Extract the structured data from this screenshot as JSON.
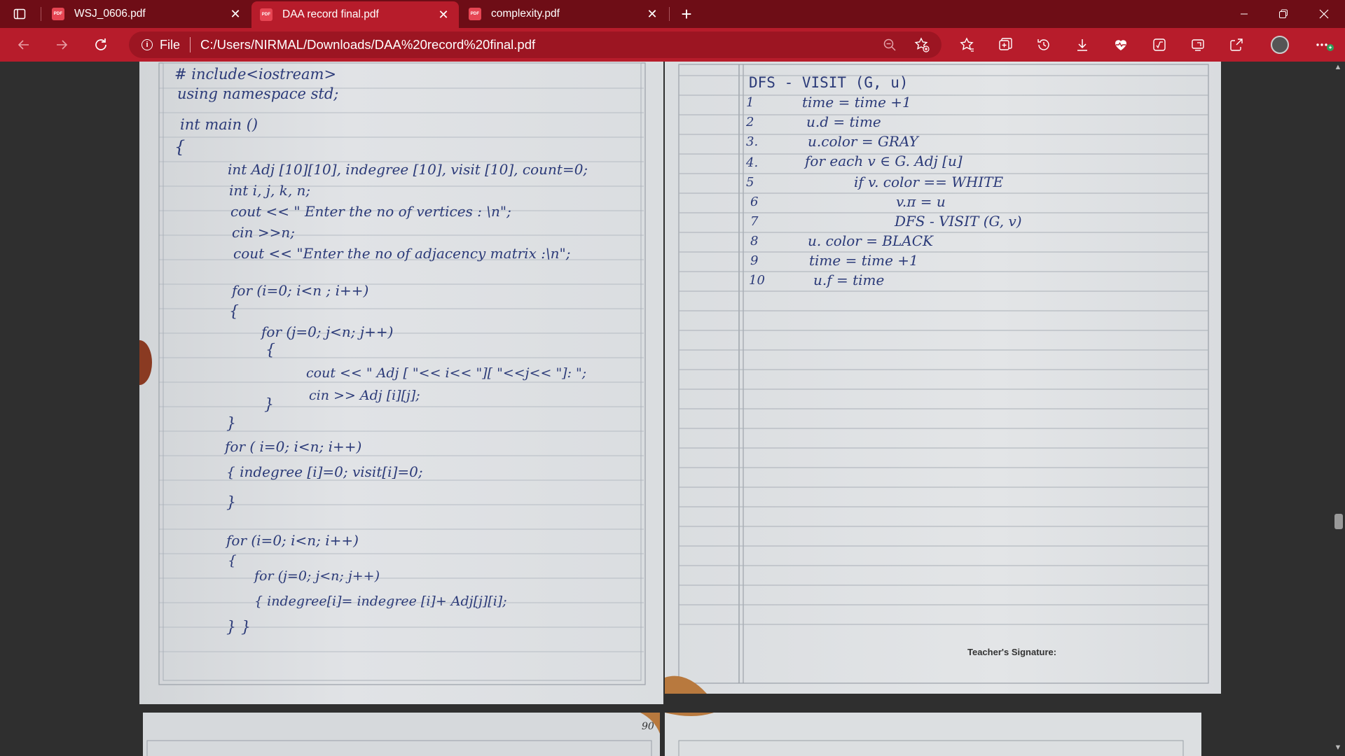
{
  "tabs": [
    {
      "title": "WSJ_0606.pdf",
      "active": false
    },
    {
      "title": "DAA record final.pdf",
      "active": true
    },
    {
      "title": "complexity.pdf",
      "active": false
    }
  ],
  "tab_icon_text": "PDF",
  "address": {
    "scheme": "File",
    "url": "C:/Users/NIRMAL/Downloads/DAA%20record%20final.pdf"
  },
  "icons": {
    "close": "✕",
    "new_tab": "+",
    "scroll_up": "▲",
    "scroll_down": "▼"
  },
  "left_page": {
    "code_lines": [
      "# include<iostream>",
      "using namespace std;",
      "int   main ()",
      "{",
      "int  Adj [10][10], indegree [10], visit [10], count=0;",
      "int  i, j, k, n;",
      "cout << \" Enter  the  no  of  vertices : \\n\";",
      "cin >>n;",
      "cout << \"Enter  the  no  of  adjacency  matrix :\\n\";",
      "for (i=0;  i<n ;  i++)",
      "{",
      "for (j=0; j<n;  j++)",
      "{",
      "cout << \" Adj [ \"<< i<< \"][ \"<<j<< \"]: \";",
      "cin >> Adj [i][j];",
      "}",
      "}",
      "for ( i=0;  i<n; i++)",
      "{  indegree [i]=0;  visit[i]=0;",
      "}",
      "for  (i=0;  i<n; i++)",
      "{",
      "for (j=0;  j<n; j++)",
      "{   indegree[i]=  indegree [i]+ Adj[j][i];",
      "}   }"
    ]
  },
  "right_page": {
    "heading": "DFS - VISIT (G, u)",
    "steps": [
      {
        "no": "1",
        "text": "time = time +1"
      },
      {
        "no": "2",
        "text": "u.d = time"
      },
      {
        "no": "3.",
        "text": "u.color = GRAY"
      },
      {
        "no": "4.",
        "text": "for  each  v ∈  G. Adj [u]"
      },
      {
        "no": "5",
        "text": "if    v. color == WHITE"
      },
      {
        "no": "6",
        "text": "v.π = u"
      },
      {
        "no": "7",
        "text": "DFS - VISIT  (G, v)"
      },
      {
        "no": "8",
        "text": "u. color  = BLACK"
      },
      {
        "no": "9",
        "text": "time = time +1"
      },
      {
        "no": "10",
        "text": "u.f = time"
      }
    ],
    "signature_label": "Teacher's Signature:"
  },
  "next_page_number": "90"
}
